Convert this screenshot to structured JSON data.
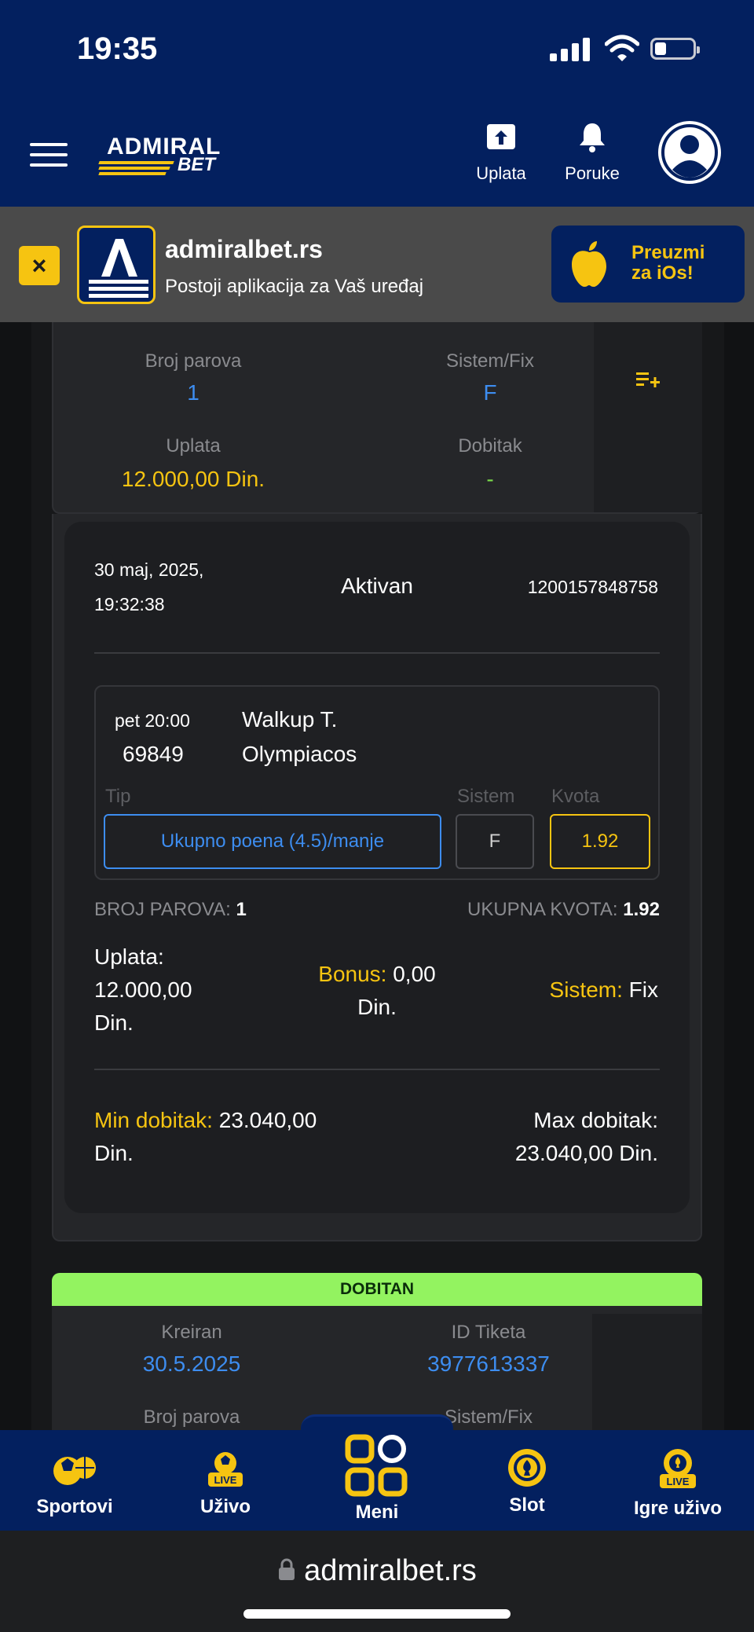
{
  "status_bar": {
    "time": "19:35"
  },
  "header": {
    "logo_top": "ADMIRAL",
    "logo_bottom": "BET",
    "deposit_label": "Uplata",
    "messages_label": "Poruke"
  },
  "app_banner": {
    "close": "×",
    "name": "admiralbet.rs",
    "description": "Postoji aplikacija za Vaš uređaj",
    "cta_line1": "Preuzmi",
    "cta_line2": "za iOs!"
  },
  "ticket_top": {
    "pairs_label": "Broj parova",
    "pairs_value": "1",
    "system_label": "Sistem/Fix",
    "system_value": "F",
    "stake_label": "Uplata",
    "stake_value": "12.000,00 Din.",
    "win_label": "Dobitak",
    "win_value": "-"
  },
  "ticket_detail": {
    "date": "30 maj, 2025,",
    "time": "19:32:38",
    "status": "Aktivan",
    "ticket_id": "1200157848758",
    "match": {
      "kickoff": "pet 20:00",
      "code": "69849",
      "home": "Walkup T.",
      "away": "Olympiacos",
      "tip_label": "Tip",
      "system_label": "Sistem",
      "odds_label": "Kvota",
      "tip_value": "Ukupno poena (4.5)/manje",
      "system_value": "F",
      "odds_value": "1.92"
    },
    "pairs_label": "BROJ PAROVA:",
    "pairs_value": "1",
    "total_odds_label": "UKUPNA KVOTA:",
    "total_odds_value": "1.92",
    "stake_label": "Uplata:",
    "stake_value_1": "12.000,00",
    "stake_value_2": "Din.",
    "bonus_label": "Bonus:",
    "bonus_value_1": "0,00",
    "bonus_value_2": "Din.",
    "system_label": "Sistem:",
    "system_value": "Fix",
    "min_win_label": "Min dobitak:",
    "min_win_value_1": "23.040,00",
    "min_win_value_2": "Din.",
    "max_win_label": "Max dobitak:",
    "max_win_value": "23.040,00 Din."
  },
  "winning_ticket": {
    "badge": "DOBITAN",
    "created_label": "Kreiran",
    "created_value": "30.5.2025",
    "id_label": "ID Tiketa",
    "id_value": "3977613337",
    "pairs_label": "Broj parova",
    "system_label": "Sistem/Fix"
  },
  "bottom_nav": {
    "sports": "Sportovi",
    "live": "Uživo",
    "menu": "Meni",
    "slot": "Slot",
    "live_games": "Igre uživo",
    "live_badge": "LIVE"
  },
  "browser": {
    "url": "admiralbet.rs"
  },
  "colors": {
    "navy": "#03205f",
    "yellow": "#f6c411",
    "blue": "#3d8df0",
    "green": "#93f360"
  }
}
